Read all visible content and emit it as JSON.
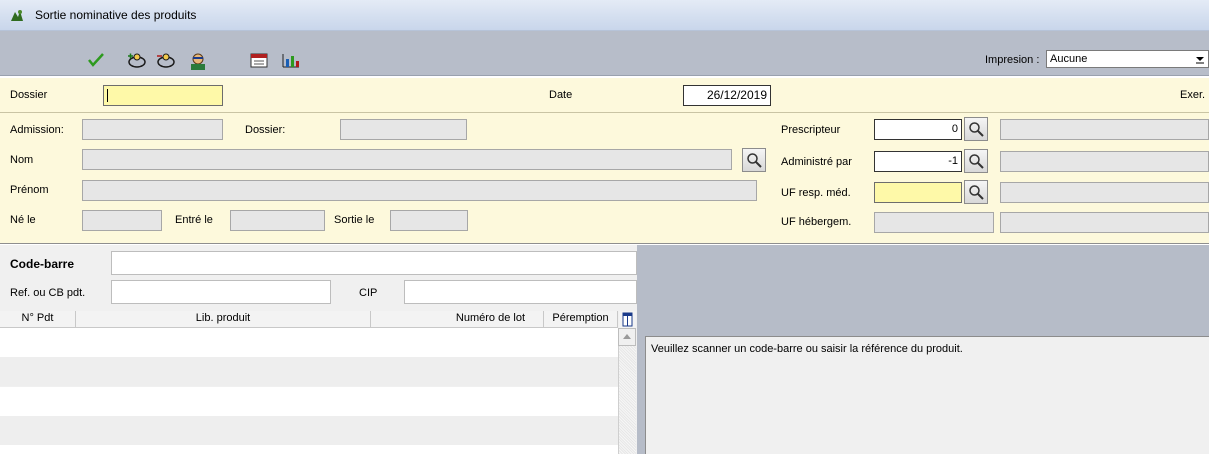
{
  "window": {
    "title": "Sortie nominative des produits"
  },
  "toolbar": {
    "icons": [
      "checkmark-icon",
      "person-add-icon",
      "person-remove-icon",
      "patient-icon",
      "calendar-icon",
      "chart-icon"
    ],
    "print_label": "Impresion :",
    "print_value": "Aucune"
  },
  "header": {
    "dossier_label": "Dossier",
    "dossier_value": "",
    "date_label": "Date",
    "date_value": "26/12/2019",
    "exer_label": "Exer."
  },
  "patient": {
    "admission_label": "Admission:",
    "dossier_label": "Dossier:",
    "nom_label": "Nom",
    "prenom_label": "Prénom",
    "ne_le_label": "Né le",
    "entre_le_label": "Entré le",
    "sortie_le_label": "Sortie le",
    "prescripteur_label": "Prescripteur",
    "prescripteur_value": "0",
    "administre_label": "Administré par",
    "administre_value": "-1",
    "uf_resp_label": "UF resp. méd.",
    "uf_heberg_label": "UF hébergem."
  },
  "scan": {
    "codebarre_label": "Code-barre",
    "ref_label": "Ref. ou CB pdt.",
    "cip_label": "CIP"
  },
  "grid": {
    "columns": [
      "N° Pdt",
      "Lib. produit",
      "Numéro de lot",
      "Péremption"
    ]
  },
  "message": "Veuillez scanner un code-barre ou saisir la référence du produit.",
  "colors": {
    "band": "#fdf9dc",
    "required_field": "#fef9a8",
    "toolbar": "#b7bdc9"
  }
}
